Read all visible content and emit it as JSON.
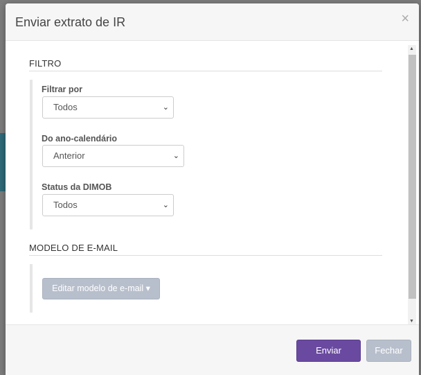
{
  "modal": {
    "title": "Enviar extrato de IR",
    "close_glyph": "×"
  },
  "filter_section": {
    "title": "FILTRO",
    "fields": [
      {
        "label": "Filtrar por",
        "value": "Todos"
      },
      {
        "label": "Do ano-calendário",
        "value": "Anterior"
      },
      {
        "label": "Status da DIMOB",
        "value": "Todos"
      }
    ]
  },
  "email_section": {
    "title": "MODELO DE E-MAIL",
    "edit_button": "Editar modelo de e-mail"
  },
  "footer": {
    "send_label": "Enviar",
    "close_label": "Fechar"
  },
  "colors": {
    "primary": "#6a4aa0",
    "disabled": "#b8bfcc"
  }
}
